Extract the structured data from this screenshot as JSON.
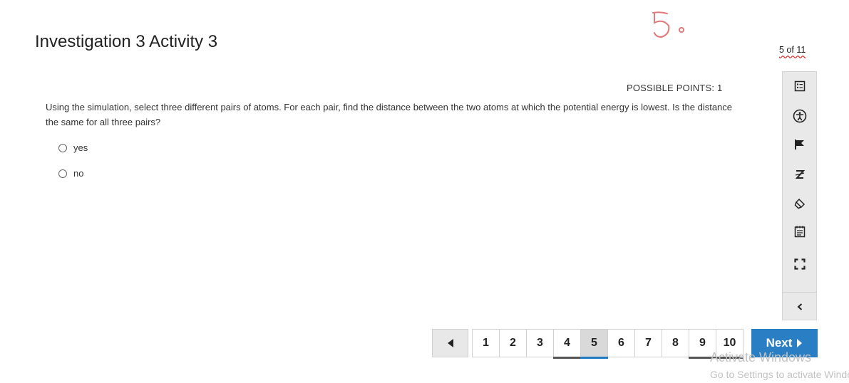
{
  "header": {
    "title": "Investigation 3 Activity 3",
    "question_counter": "5 of 11",
    "annotation_mark": "5"
  },
  "question": {
    "points": "POSSIBLE POINTS: 1",
    "text": "Using the simulation, select three different pairs of atoms. For each pair, find the distance between the two atoms at which the potential energy is lowest. Is the distance the same for all three pairs?",
    "options": [
      "yes",
      "no"
    ]
  },
  "toolbar": {
    "icons": [
      "question-list-icon",
      "accessibility-icon",
      "flag-icon",
      "line-reader-icon",
      "highlighter-icon",
      "notepad-icon",
      "fullscreen-icon",
      "collapse-chevron-icon"
    ]
  },
  "navigation": {
    "pages": [
      "1",
      "2",
      "3",
      "4",
      "5",
      "6",
      "7",
      "8",
      "9",
      "10"
    ],
    "current_page": "5",
    "next_label": "Next"
  },
  "watermark": {
    "line1": "Activate Windows",
    "line2": "Go to Settings to activate Windows."
  }
}
